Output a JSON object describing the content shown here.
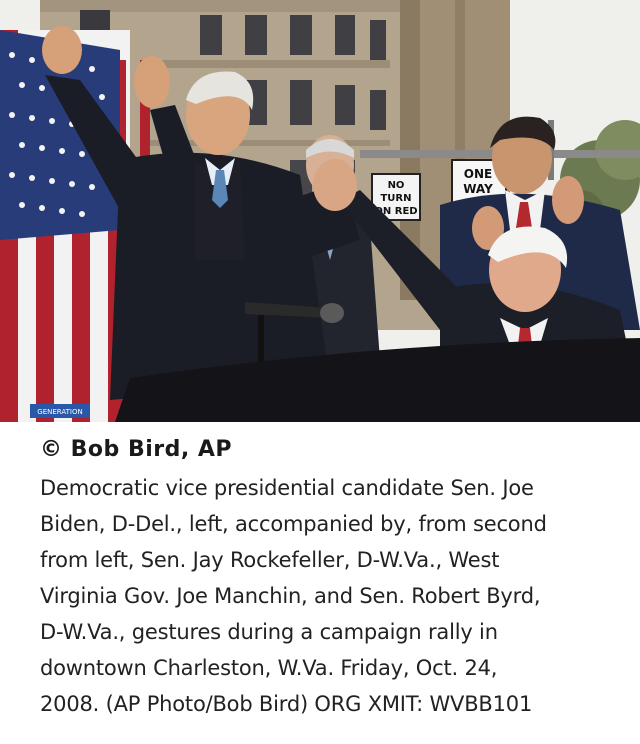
{
  "photo": {
    "signs": {
      "no_turn_on_red": [
        "NO",
        "TURN",
        "ON RED"
      ],
      "one_way": [
        "ONE",
        "WAY"
      ]
    },
    "banner_text": "GENERATION",
    "colors": {
      "sky": "#f4f4f2",
      "building": "#b7a88f",
      "flag_red": "#b0222e",
      "flag_blue": "#2b3f7a",
      "suit_dark": "#1b1d26",
      "table": "#141418"
    }
  },
  "credit": "© Bob Bird, AP",
  "caption": [
    "Democratic vice presidential candidate Sen. Joe",
    "Biden, D-Del., left, accompanied by, from second",
    "from left, Sen. Jay Rockefeller, D-W.Va., West",
    "Virginia Gov. Joe Manchin, and Sen. Robert Byrd,",
    "D-W.Va., gestures during a campaign rally in",
    "downtown Charleston, W.Va. Friday, Oct. 24,",
    "2008. (AP Photo/Bob Bird) ORG XMIT: WVBB101"
  ]
}
